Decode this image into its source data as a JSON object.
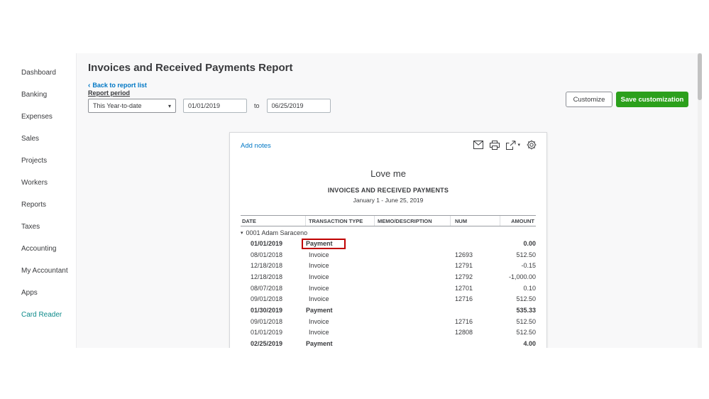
{
  "sidebar": {
    "items": [
      {
        "label": "Dashboard",
        "accent": false
      },
      {
        "label": "Banking",
        "accent": false
      },
      {
        "label": "Expenses",
        "accent": false
      },
      {
        "label": "Sales",
        "accent": false
      },
      {
        "label": "Projects",
        "accent": false
      },
      {
        "label": "Workers",
        "accent": false
      },
      {
        "label": "Reports",
        "accent": false
      },
      {
        "label": "Taxes",
        "accent": false
      },
      {
        "label": "Accounting",
        "accent": false
      },
      {
        "label": "My Accountant",
        "accent": false
      },
      {
        "label": "Apps",
        "accent": false
      },
      {
        "label": "Card Reader",
        "accent": true
      }
    ]
  },
  "header": {
    "title": "Invoices and Received Payments Report",
    "back_link": "Back to report list",
    "report_period_label": "Report period",
    "period_value": "This Year-to-date",
    "date_from": "01/01/2019",
    "to_label": "to",
    "date_to": "06/25/2019",
    "customize_label": "Customize",
    "save_customization_label": "Save customization"
  },
  "report": {
    "add_notes_label": "Add notes",
    "company": "Love me",
    "title": "INVOICES AND RECEIVED PAYMENTS",
    "period": "January 1 - June 25, 2019",
    "columns": [
      "DATE",
      "TRANSACTION TYPE",
      "MEMO/DESCRIPTION",
      "NUM",
      "AMOUNT"
    ],
    "group": "0001 Adam Saraceno",
    "rows": [
      {
        "date": "01/01/2019",
        "type": "Payment",
        "memo": "",
        "num": "",
        "amount": "0.00",
        "bold": true,
        "highlight": true
      },
      {
        "date": "08/01/2018",
        "type": "Invoice",
        "memo": "",
        "num": "12693",
        "amount": "512.50",
        "bold": false,
        "highlight": false
      },
      {
        "date": "12/18/2018",
        "type": "Invoice",
        "memo": "",
        "num": "12791",
        "amount": "-0.15",
        "bold": false,
        "highlight": false
      },
      {
        "date": "12/18/2018",
        "type": "Invoice",
        "memo": "",
        "num": "12792",
        "amount": "-1,000.00",
        "bold": false,
        "highlight": false
      },
      {
        "date": "08/07/2018",
        "type": "Invoice",
        "memo": "",
        "num": "12701",
        "amount": "0.10",
        "bold": false,
        "highlight": false
      },
      {
        "date": "09/01/2018",
        "type": "Invoice",
        "memo": "",
        "num": "12716",
        "amount": "512.50",
        "bold": false,
        "highlight": false
      },
      {
        "date": "01/30/2019",
        "type": "Payment",
        "memo": "",
        "num": "",
        "amount": "535.33",
        "bold": true,
        "highlight": false
      },
      {
        "date": "09/01/2018",
        "type": "Invoice",
        "memo": "",
        "num": "12716",
        "amount": "512.50",
        "bold": false,
        "highlight": false
      },
      {
        "date": "01/01/2019",
        "type": "Invoice",
        "memo": "",
        "num": "12808",
        "amount": "512.50",
        "bold": false,
        "highlight": false
      },
      {
        "date": "02/25/2019",
        "type": "Payment",
        "memo": "",
        "num": "",
        "amount": "4.00",
        "bold": true,
        "highlight": false
      }
    ]
  },
  "glyphs": {
    "back_chevron": "‹",
    "dropdown_caret": "▾",
    "collapse_caret": "▾",
    "export_caret": "▾"
  },
  "colors": {
    "link": "#0077c5",
    "accent_green": "#2ca01c",
    "sidebar_accent": "#0d8a8a",
    "highlight_border": "#c00000",
    "text": "#393a3d"
  }
}
